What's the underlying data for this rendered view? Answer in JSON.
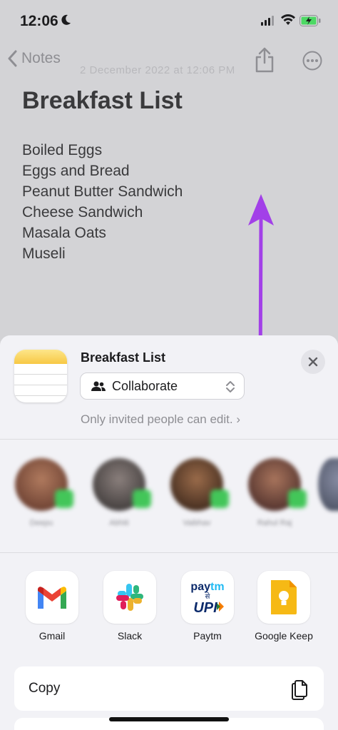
{
  "status": {
    "time": "12:06"
  },
  "nav": {
    "back_label": "Notes",
    "ghost_date": "2 December 2022 at 12:06 PM"
  },
  "note": {
    "title": "Breakfast List",
    "lines": [
      "Boiled Eggs",
      "Eggs and Bread",
      "Peanut Butter Sandwich",
      "Cheese Sandwich",
      "Masala Oats",
      "Museli"
    ]
  },
  "sheet": {
    "title": "Breakfast List",
    "collaborate_label": "Collaborate",
    "invite_text": "Only invited people can edit.",
    "people": [
      {
        "name": "Deepu",
        "color": "#7a4a3c"
      },
      {
        "name": "Abhiti",
        "color": "#3e3a3a"
      },
      {
        "name": "Vaibhav",
        "color": "#4a3322"
      },
      {
        "name": "Rahul Raj",
        "color": "#5a3a30"
      }
    ],
    "apps": [
      {
        "label": "Gmail"
      },
      {
        "label": "Slack"
      },
      {
        "label": "Paytm"
      },
      {
        "label": "Google Keep"
      }
    ],
    "copy_label": "Copy"
  },
  "colors": {
    "accent_arrow": "#a240e8",
    "keep_yellow": "#f6b915",
    "paytm_blue": "#0b2a6b",
    "paytm_light": "#20baf3"
  }
}
